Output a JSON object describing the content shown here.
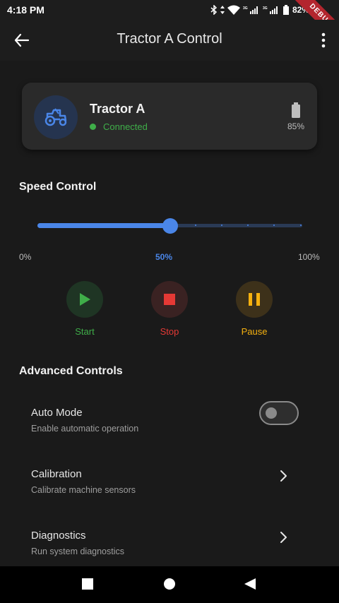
{
  "status_bar": {
    "time": "4:18 PM",
    "battery": "82%",
    "debug": "DEBUG"
  },
  "app_bar": {
    "title": "Tractor A Control"
  },
  "device": {
    "name": "Tractor A",
    "status": "Connected",
    "battery": "85%",
    "accent": "#4a86e8",
    "status_color": "#3fae49"
  },
  "speed": {
    "title": "Speed Control",
    "value": 0.5,
    "min_label": "0%",
    "current_label": "50%",
    "max_label": "100%"
  },
  "actions": [
    {
      "label": "Start",
      "icon": "play-icon",
      "color": "#3fae49"
    },
    {
      "label": "Stop",
      "icon": "stop-icon",
      "color": "#e53935"
    },
    {
      "label": "Pause",
      "icon": "pause-icon",
      "color": "#f6b10f"
    }
  ],
  "advanced": {
    "title": "Advanced Controls",
    "items": [
      {
        "title": "Auto Mode",
        "subtitle": "Enable automatic operation",
        "control": "toggle",
        "enabled": false
      },
      {
        "title": "Calibration",
        "subtitle": "Calibrate machine sensors",
        "control": "chevron"
      },
      {
        "title": "Diagnostics",
        "subtitle": "Run system diagnostics",
        "control": "chevron"
      }
    ]
  }
}
